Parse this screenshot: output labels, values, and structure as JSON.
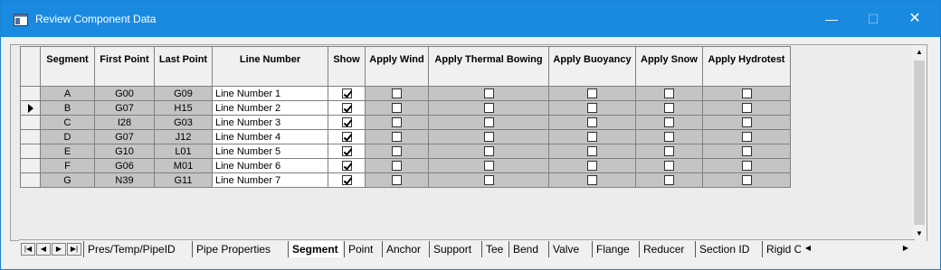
{
  "window": {
    "title": "Review Component Data",
    "minimize": "—",
    "maximize": "☐",
    "close": "✕"
  },
  "grid": {
    "columns": [
      "Segment",
      "First Point",
      "Last Point",
      "Line Number",
      "Show",
      "Apply Wind",
      "Apply Thermal Bowing",
      "Apply Buoyancy",
      "Apply Snow",
      "Apply Hydrotest"
    ],
    "rows": [
      {
        "segment": "A",
        "first": "G00",
        "last": "G09",
        "line": "Line Number 1",
        "show": true,
        "wind": false,
        "thermal": false,
        "buoyancy": false,
        "snow": false,
        "hydrotest": false
      },
      {
        "segment": "B",
        "first": "G07",
        "last": "H15",
        "line": "Line Number 2",
        "show": true,
        "wind": false,
        "thermal": false,
        "buoyancy": false,
        "snow": false,
        "hydrotest": false
      },
      {
        "segment": "C",
        "first": "I28",
        "last": "G03",
        "line": "Line Number 3",
        "show": true,
        "wind": false,
        "thermal": false,
        "buoyancy": false,
        "snow": false,
        "hydrotest": false
      },
      {
        "segment": "D",
        "first": "G07",
        "last": "J12",
        "line": "Line Number 4",
        "show": true,
        "wind": false,
        "thermal": false,
        "buoyancy": false,
        "snow": false,
        "hydrotest": false
      },
      {
        "segment": "E",
        "first": "G10",
        "last": "L01",
        "line": "Line Number 5",
        "show": true,
        "wind": false,
        "thermal": false,
        "buoyancy": false,
        "snow": false,
        "hydrotest": false
      },
      {
        "segment": "F",
        "first": "G06",
        "last": "M01",
        "line": "Line Number 6",
        "show": true,
        "wind": false,
        "thermal": false,
        "buoyancy": false,
        "snow": false,
        "hydrotest": false
      },
      {
        "segment": "G",
        "first": "N39",
        "last": "G11",
        "line": "Line Number 7",
        "show": true,
        "wind": false,
        "thermal": false,
        "buoyancy": false,
        "snow": false,
        "hydrotest": false
      }
    ],
    "current_row_index": 1
  },
  "tabs": [
    "Pres/Temp/PipeID",
    "Pipe Properties",
    "Segment",
    "Point",
    "Anchor",
    "Support",
    "Tee",
    "Bend",
    "Valve",
    "Flange",
    "Reducer",
    "Section ID",
    "Rigid Op"
  ],
  "active_tab": "Segment",
  "colors": {
    "titlebar": "#1a8ae0",
    "readonly_cell": "#c4c4c4",
    "window_bg": "#f0f0f0"
  }
}
